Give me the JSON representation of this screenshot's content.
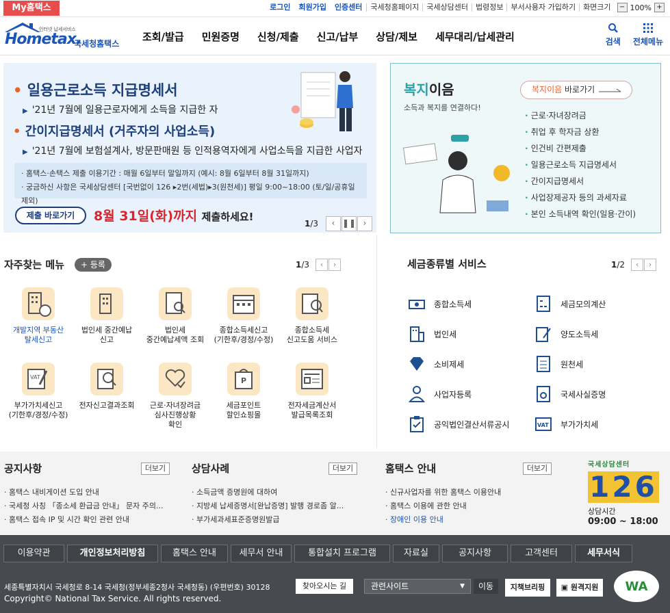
{
  "topbar": {
    "myhome": "My홈택스",
    "login": "로그인",
    "signup": "회원가입",
    "cert": "인증센터",
    "links": [
      "국세청홈페이지",
      "국세상담센터",
      "법령정보",
      "부서사용자 가입하기",
      "화면크기"
    ],
    "zoom_minus": "−",
    "zoom_value": "100%",
    "zoom_plus": "+"
  },
  "header": {
    "logo_small": "인터넷 납세서비스",
    "logo_main": "Hometax.",
    "logo_kor": "국세청홈택스",
    "nav": [
      "조회/발급",
      "민원증명",
      "신청/제출",
      "신고/납부",
      "상담/제보",
      "세무대리/납세관리"
    ],
    "search_label": "검색",
    "menu_label": "전체메뉴"
  },
  "banner": {
    "h1": "일용근로소득 지급명세서",
    "l1": "'21년 7월에 일용근로자에게 소득을 지급한 자",
    "h2": "간이지급명세서 (거주자의 사업소득)",
    "l2": "'21년 7월에 보험설계사, 방문판매원 등 인적용역자에게 사업소득을 지급한 사업자",
    "info1": "· 홈택스·손택스 제출 이용기간 : 매월 6일부터 말일까지 (예시: 8월 6일부터 8월 31일까지)",
    "info2": "· 궁금하신 사항은 국세상담센터 [국번없이 126 ▸2번(세법)▸3(원천세)] 평일 9:00~18:00 (토/일/공휴일 제외)",
    "button": "제출 바로가기",
    "deadline": "8월 31일(화)까지",
    "deadline_suffix": "제출하세요!",
    "page": "1/3",
    "page_current": "1",
    "page_total": "/3"
  },
  "welfare": {
    "title_green": "복지",
    "title_rest": "이음",
    "subtitle": "소득과 복지를 연결하다!",
    "btn_red": "복지이음",
    "btn_rest": " 바로가기",
    "items": [
      "근로·자녀장려금",
      "취업 후 학자금 상환",
      "인건비 간편제출",
      "일용근로소득 지급명세서",
      "간이지급명세서",
      "사업장제공자 등의 과세자료",
      "본인 소득내역 확인(일용·간이)"
    ]
  },
  "favorites": {
    "title": "자주찾는 메뉴",
    "add": "+ 등록",
    "page_current": "1",
    "page_total": "/3",
    "items": [
      {
        "label": "개발지역 부동산\n탈세신고",
        "highlight": true,
        "icon": "building-money-icon"
      },
      {
        "label": "법인세 중간예납\n신고",
        "highlight": false,
        "icon": "building-icon"
      },
      {
        "label": "법인세\n중간예납세액 조회",
        "highlight": false,
        "icon": "document-search-icon"
      },
      {
        "label": "종합소득세신고\n(기한후/경정/수정)",
        "highlight": false,
        "icon": "calendar-icon"
      },
      {
        "label": "종합소득세\n신고도움 서비스",
        "highlight": false,
        "icon": "money-search-icon"
      },
      {
        "label": "부가가치세신고\n(기한후/경정/수정)",
        "highlight": false,
        "icon": "vat-pen-icon"
      },
      {
        "label": "전자신고결과조회",
        "highlight": false,
        "icon": "result-search-icon"
      },
      {
        "label": "근로·자녀장려금\n심사진행상황\n확인",
        "highlight": false,
        "icon": "heart-hand-icon"
      },
      {
        "label": "세금포인트\n할인쇼핑몰",
        "highlight": false,
        "icon": "point-bag-icon"
      },
      {
        "label": "전자세금계산서\n발급목록조회",
        "highlight": false,
        "icon": "invoice-list-icon"
      }
    ]
  },
  "taxtypes": {
    "title": "세금종류별 서비스",
    "page_current": "1",
    "page_total": "/2",
    "items": [
      "종합소득세",
      "세금모의계산",
      "법인세",
      "양도소득세",
      "소비제세",
      "원천세",
      "사업자등록",
      "국세사실증명",
      "공익법인결산서류공시",
      "부가가치세"
    ]
  },
  "notices": {
    "more": "더보기",
    "notice_title": "공지사항",
    "notice_items": [
      "홈택스 내비게이션 도입 안내",
      "국세청 사칭 「종소세 환급금 안내」 문자 주의...",
      "홈택스 접속 IP 및 시간 확인 관련 안내"
    ],
    "consult_title": "상담사례",
    "consult_items": [
      "소득금액 증명원에 대하여",
      "지방세 납세증명서[완납증명] 발행 경로좀 알...",
      "부가세과세표준증명원발급"
    ],
    "guide_title": "홈택스 안내",
    "guide_items": [
      "신규사업자를 위한 홈택스 이용안내",
      "홈택스 이용에 관한 안내",
      "장애인 이용 안내"
    ]
  },
  "center": {
    "label": "국세상담센터",
    "number": "126",
    "hours_label": "상담시간",
    "hours": "09:00 ~ 18:00"
  },
  "footer": {
    "nav": [
      "이용약관",
      "개인정보처리방침",
      "홈택스 안내",
      "세무서 안내",
      "통합설치 프로그램",
      "자료실",
      "공지사항",
      "고객센터",
      "세무서식"
    ],
    "address": "세종특별자치시 국세청로 8-14 국세청(정부세종2청사 국세청동) (우편번호) 30128",
    "map_btn": "찾아오시는 길",
    "select": "관련사이트",
    "go": "이동",
    "badge1": "지책브리핑",
    "badge2": "원격지원",
    "wa": "WA",
    "copyright": "Copyright© National Tax Service. All rights reserved."
  },
  "colors": {
    "accent": "#1b55b8",
    "red": "#d8262d",
    "orange": "#e8622d",
    "teal": "#2da1a8",
    "footer": "#474b50"
  }
}
